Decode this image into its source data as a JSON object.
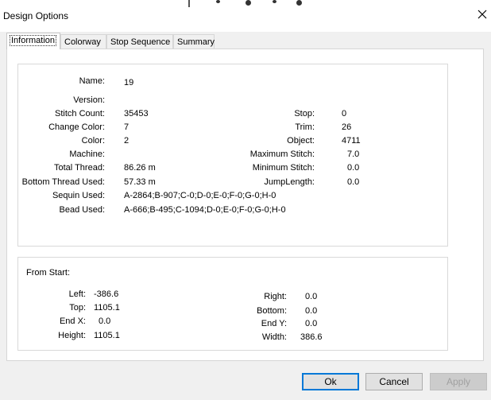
{
  "window": {
    "title": "Design Options"
  },
  "tabs": [
    {
      "label": "Information"
    },
    {
      "label": "Colorway"
    },
    {
      "label": "Stop Sequence"
    },
    {
      "label": "Summary"
    }
  ],
  "info": {
    "name_label": "Name:",
    "name_value": "19",
    "version_label": "Version:",
    "version_value": "",
    "stitch_count_label": "Stitch Count:",
    "stitch_count_value": "35453",
    "change_color_label": "Change Color:",
    "change_color_value": "7",
    "color_label": "Color:",
    "color_value": "2",
    "machine_label": "Machine:",
    "machine_value": "",
    "total_thread_label": "Total Thread:",
    "total_thread_value": "86.26 m",
    "bottom_thread_label": "Bottom Thread Used:",
    "bottom_thread_value": "57.33 m",
    "sequin_label": "Sequin Used:",
    "sequin_value": "A-2864;B-907;C-0;D-0;E-0;F-0;G-0;H-0",
    "bead_label": "Bead Used:",
    "bead_value": "A-666;B-495;C-1094;D-0;E-0;F-0;G-0;H-0",
    "stop_label": "Stop:",
    "stop_value": "0",
    "trim_label": "Trim:",
    "trim_value": "26",
    "object_label": "Object:",
    "object_value": "4711",
    "max_stitch_label": "Maximum Stitch:",
    "max_stitch_value": "7.0",
    "min_stitch_label": "Minimum Stitch:",
    "min_stitch_value": "0.0",
    "jump_length_label": "JumpLength:",
    "jump_length_value": "0.0"
  },
  "from_start": {
    "heading": "From Start:",
    "left_label": "Left:",
    "left_value": "-386.6",
    "top_label": "Top:",
    "top_value": "1105.1",
    "endx_label": "End X:",
    "endx_value": "0.0",
    "height_label": "Height:",
    "height_value": "1105.1",
    "right_label": "Right:",
    "right_value": "0.0",
    "bottom_label": "Bottom:",
    "bottom_value": "0.0",
    "endy_label": "End Y:",
    "endy_value": "0.0",
    "width_label": "Width:",
    "width_value": "386.6"
  },
  "buttons": {
    "ok": "Ok",
    "cancel": "Cancel",
    "apply": "Apply"
  }
}
